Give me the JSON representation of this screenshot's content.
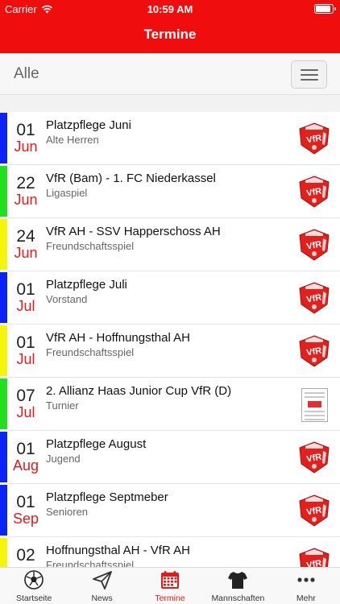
{
  "status": {
    "carrier": "Carrier",
    "time": "10:59 AM",
    "battery_level": 0.95
  },
  "nav": {
    "title": "Termine"
  },
  "filter": {
    "label": "Alle"
  },
  "events": [
    {
      "day": "01",
      "month": "Jun",
      "title": "Platzpflege Juni",
      "subtitle": "Alte Herren",
      "stripe": "#0b24f5",
      "image": "vfr-logo"
    },
    {
      "day": "22",
      "month": "Jun",
      "title": "VfR (Bam) - 1. FC Niederkassel",
      "subtitle": "Ligaspiel",
      "stripe": "#22e01f",
      "image": "vfr-logo"
    },
    {
      "day": "24",
      "month": "Jun",
      "title": "VfR AH - SSV Happerschoss AH",
      "subtitle": "Freundschaftsspiel",
      "stripe": "#f5f50c",
      "image": "vfr-logo"
    },
    {
      "day": "01",
      "month": "Jul",
      "title": "Platzpflege Juli",
      "subtitle": "Vorstand",
      "stripe": "#0b24f5",
      "image": "vfr-logo"
    },
    {
      "day": "01",
      "month": "Jul",
      "title": "VfR AH - Hoffnungsthal AH",
      "subtitle": "Freundschaftsspiel",
      "stripe": "#f5f50c",
      "image": "vfr-logo"
    },
    {
      "day": "07",
      "month": "Jul",
      "title": "2. Allianz Haas Junior Cup VfR (D)",
      "subtitle": "Turnier",
      "stripe": "#22e01f",
      "image": "poster"
    },
    {
      "day": "01",
      "month": "Aug",
      "title": "Platzpflege August",
      "subtitle": "Jugend",
      "stripe": "#0b24f5",
      "image": "vfr-logo"
    },
    {
      "day": "01",
      "month": "Sep",
      "title": "Platzpflege Septmeber",
      "subtitle": "Senioren",
      "stripe": "#0b24f5",
      "image": "vfr-logo"
    },
    {
      "day": "02",
      "month": "",
      "title": "Hoffnungsthal AH - VfR AH",
      "subtitle": "Freundschaftsspiel",
      "stripe": "#f5f50c",
      "image": "vfr-logo"
    }
  ],
  "tabs": [
    {
      "label": "Startseite",
      "icon": "soccer-ball-icon",
      "active": false
    },
    {
      "label": "News",
      "icon": "paper-plane-icon",
      "active": false
    },
    {
      "label": "Termine",
      "icon": "calendar-icon",
      "active": true
    },
    {
      "label": "Mannschaften",
      "icon": "jersey-icon",
      "active": false
    },
    {
      "label": "Mehr",
      "icon": "more-dots-icon",
      "active": false
    }
  ],
  "colors": {
    "accent": "#f00d0d",
    "month_text": "#e21a1a"
  }
}
